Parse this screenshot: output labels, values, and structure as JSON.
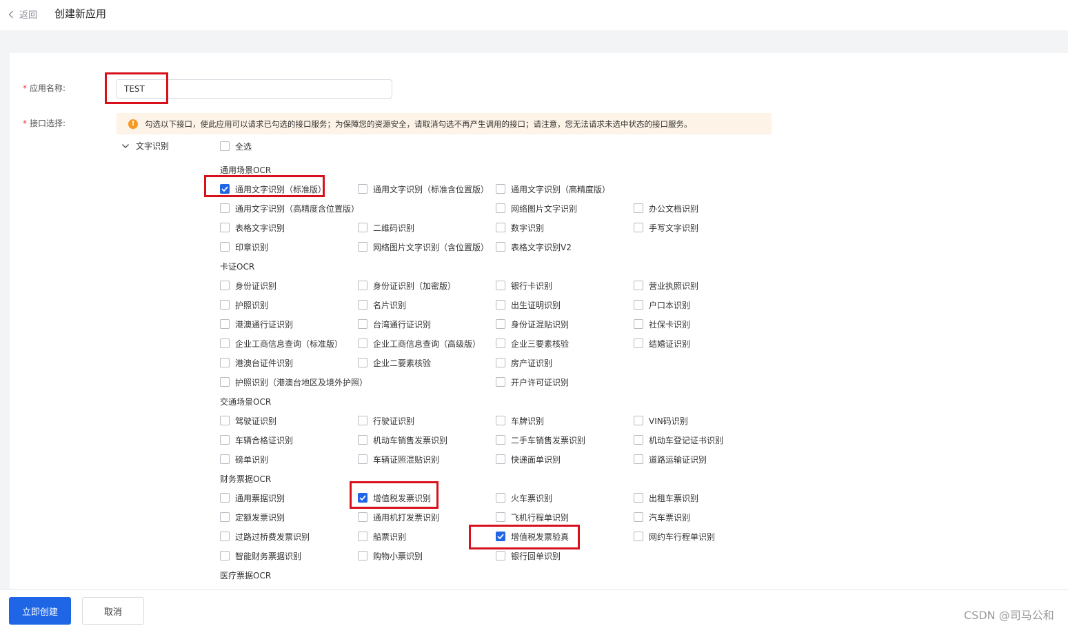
{
  "header": {
    "back_label": "返回",
    "title": "创建新应用"
  },
  "form": {
    "name_label": "应用名称:",
    "name_value": "TEST",
    "api_label": "接口选择:",
    "notice": "勾选以下接口，使此应用可以请求已勾选的接口服务；为保障您的资源安全，请取消勾选不再产生调用的接口；请注意，您无法请求未选中状态的接口服务。",
    "group_label": "文字识别",
    "select_all": "全选"
  },
  "categories": [
    {
      "name": "通用场景OCR",
      "items": [
        {
          "label": "通用文字识别（标准版）",
          "checked": true
        },
        {
          "label": "通用文字识别（标准含位置版）",
          "checked": false
        },
        {
          "label": "通用文字识别（高精度版）",
          "checked": false
        },
        {
          "label": "通用文字识别（高精度含位置版）",
          "checked": false
        },
        {
          "label": "网络图片文字识别",
          "checked": false
        },
        {
          "label": "办公文档识别",
          "checked": false
        },
        {
          "label": "表格文字识别",
          "checked": false
        },
        {
          "label": "二维码识别",
          "checked": false
        },
        {
          "label": "数字识别",
          "checked": false
        },
        {
          "label": "手写文字识别",
          "checked": false
        },
        {
          "label": "印章识别",
          "checked": false
        },
        {
          "label": "网络图片文字识别（含位置版）",
          "checked": false
        },
        {
          "label": "表格文字识别V2",
          "checked": false
        }
      ]
    },
    {
      "name": "卡证OCR",
      "items": [
        {
          "label": "身份证识别",
          "checked": false
        },
        {
          "label": "身份证识别（加密版）",
          "checked": false
        },
        {
          "label": "银行卡识别",
          "checked": false
        },
        {
          "label": "营业执照识别",
          "checked": false
        },
        {
          "label": "护照识别",
          "checked": false
        },
        {
          "label": "名片识别",
          "checked": false
        },
        {
          "label": "出生证明识别",
          "checked": false
        },
        {
          "label": "户口本识别",
          "checked": false
        },
        {
          "label": "港澳通行证识别",
          "checked": false
        },
        {
          "label": "台湾通行证识别",
          "checked": false
        },
        {
          "label": "身份证混贴识别",
          "checked": false
        },
        {
          "label": "社保卡识别",
          "checked": false
        },
        {
          "label": "企业工商信息查询（标准版）",
          "checked": false
        },
        {
          "label": "企业工商信息查询（高级版）",
          "checked": false
        },
        {
          "label": "企业三要素核验",
          "checked": false
        },
        {
          "label": "结婚证识别",
          "checked": false
        },
        {
          "label": "港澳台证件识别",
          "checked": false
        },
        {
          "label": "企业二要素核验",
          "checked": false
        },
        {
          "label": "房产证识别",
          "checked": false
        },
        {
          "label": "护照识别（港澳台地区及境外护照）",
          "checked": false
        },
        {
          "label": "开户许可证识别",
          "checked": false
        }
      ]
    },
    {
      "name": "交通场景OCR",
      "items": [
        {
          "label": "驾驶证识别",
          "checked": false
        },
        {
          "label": "行驶证识别",
          "checked": false
        },
        {
          "label": "车牌识别",
          "checked": false
        },
        {
          "label": "VIN码识别",
          "checked": false
        },
        {
          "label": "车辆合格证识别",
          "checked": false
        },
        {
          "label": "机动车销售发票识别",
          "checked": false
        },
        {
          "label": "二手车销售发票识别",
          "checked": false
        },
        {
          "label": "机动车登记证书识别",
          "checked": false
        },
        {
          "label": "磅单识别",
          "checked": false
        },
        {
          "label": "车辆证照混贴识别",
          "checked": false
        },
        {
          "label": "快递面单识别",
          "checked": false
        },
        {
          "label": "道路运输证识别",
          "checked": false
        }
      ]
    },
    {
      "name": "财务票据OCR",
      "items": [
        {
          "label": "通用票据识别",
          "checked": false
        },
        {
          "label": "增值税发票识别",
          "checked": true
        },
        {
          "label": "火车票识别",
          "checked": false
        },
        {
          "label": "出租车票识别",
          "checked": false
        },
        {
          "label": "定额发票识别",
          "checked": false
        },
        {
          "label": "通用机打发票识别",
          "checked": false
        },
        {
          "label": "飞机行程单识别",
          "checked": false
        },
        {
          "label": "汽车票识别",
          "checked": false
        },
        {
          "label": "过路过桥费发票识别",
          "checked": false
        },
        {
          "label": "船票识别",
          "checked": false
        },
        {
          "label": "增值税发票验真",
          "checked": true
        },
        {
          "label": "网约车行程单识别",
          "checked": false
        },
        {
          "label": "智能财务票据识别",
          "checked": false
        },
        {
          "label": "购物小票识别",
          "checked": false
        },
        {
          "label": "银行回单识别",
          "checked": false
        }
      ]
    },
    {
      "name": "医疗票据OCR",
      "items": []
    }
  ],
  "footer": {
    "create_label": "立即创建",
    "cancel_label": "取消"
  },
  "watermark": "CSDN @司马公和",
  "colors": {
    "primary": "#1e66e6",
    "highlight": "#d8101b",
    "required": "#f04134",
    "warning": "#f59a23"
  }
}
